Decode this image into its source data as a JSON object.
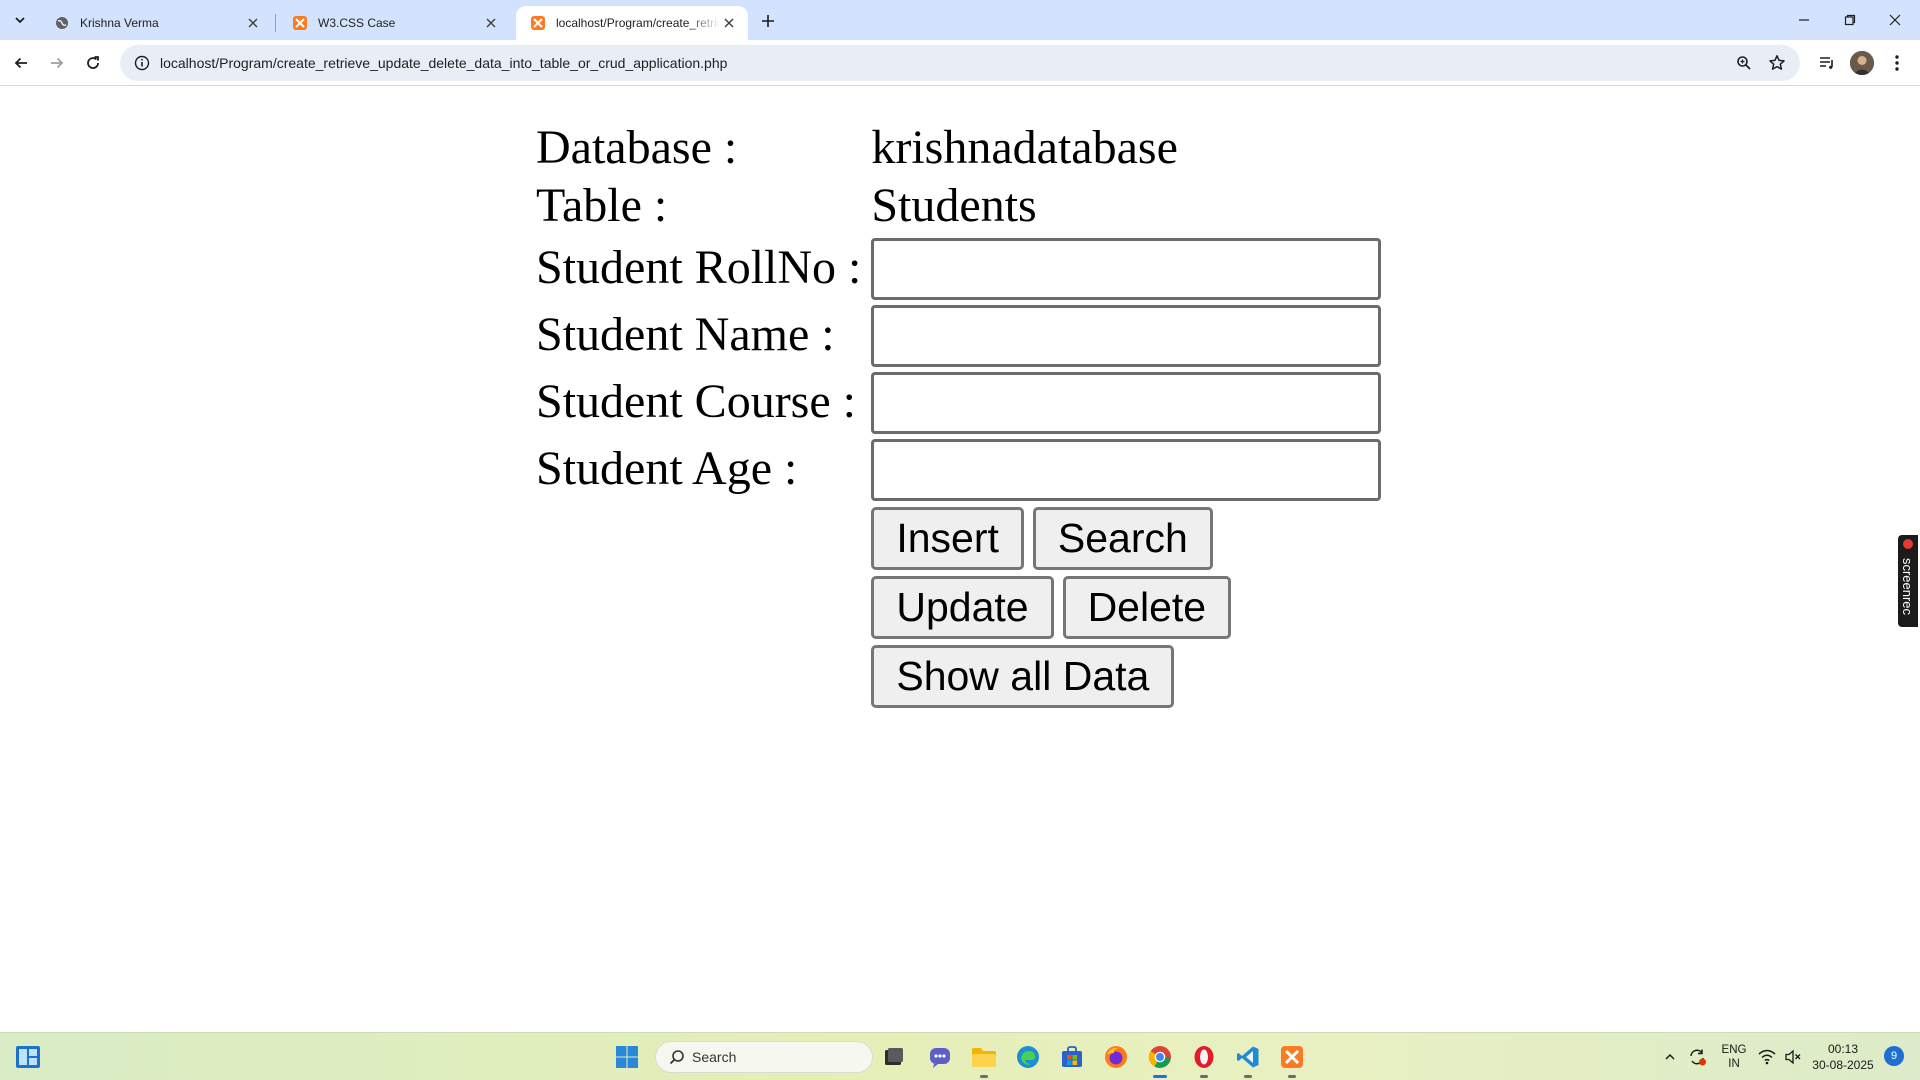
{
  "browser": {
    "tabs": [
      {
        "title": "Krishna Verma",
        "favicon": "globe-icon",
        "active": false
      },
      {
        "title": "W3.CSS Case",
        "favicon": "xampp-icon",
        "active": false
      },
      {
        "title": "localhost/Program/create_retrie",
        "favicon": "xampp-icon",
        "active": true
      }
    ],
    "url": "localhost/Program/create_retrieve_update_delete_data_into_table_or_crud_application.php"
  },
  "page": {
    "database_label": "Database :",
    "database_value": "krishnadatabase",
    "table_label": "Table :",
    "table_value": "Students",
    "fields": [
      {
        "label": "Student RollNo :",
        "value": ""
      },
      {
        "label": "Student Name :",
        "value": ""
      },
      {
        "label": "Student Course :",
        "value": ""
      },
      {
        "label": "Student Age :",
        "value": ""
      }
    ],
    "buttons": {
      "insert": "Insert",
      "search": "Search",
      "update": "Update",
      "delete": "Delete",
      "show_all": "Show all Data"
    }
  },
  "overlay": {
    "screenrec_label": "screenrec"
  },
  "taskbar": {
    "search_placeholder": "Search",
    "lang_line1": "ENG",
    "lang_line2": "IN",
    "time": "00:13",
    "date": "30-08-2025",
    "notification_count": "9"
  },
  "colors": {
    "tabstrip": "#d3e3fd",
    "omnibox": "#e9eef6",
    "button_bg": "#efefef",
    "xampp_orange": "#fb7a24"
  }
}
